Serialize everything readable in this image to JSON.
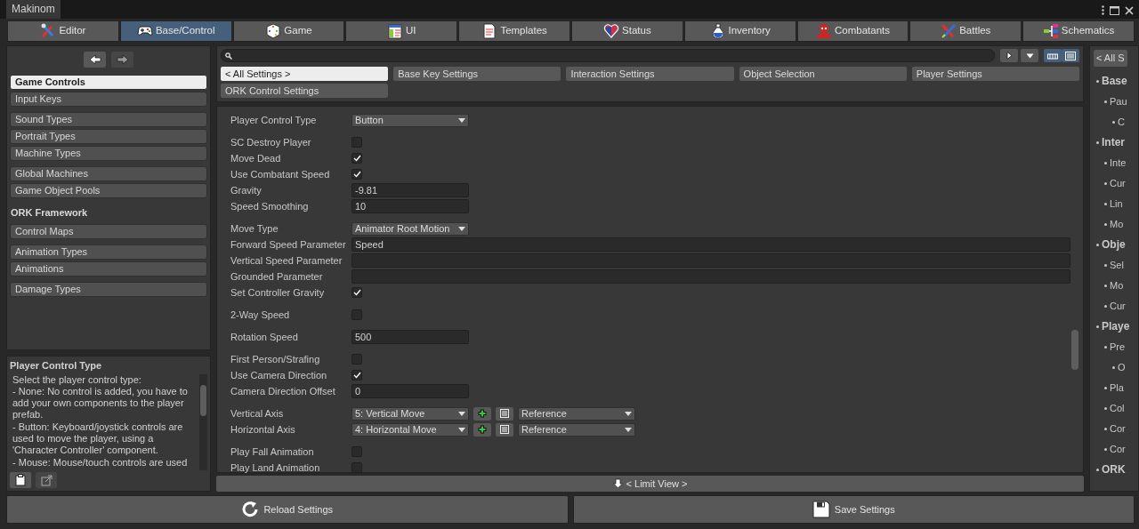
{
  "window": {
    "title": "Makinom"
  },
  "tabs": [
    {
      "label": "Editor",
      "selected": false
    },
    {
      "label": "Base/Control",
      "selected": true
    },
    {
      "label": "Game",
      "selected": false
    },
    {
      "label": "UI",
      "selected": false
    },
    {
      "label": "Templates",
      "selected": false
    },
    {
      "label": "Status",
      "selected": false
    },
    {
      "label": "Inventory",
      "selected": false
    },
    {
      "label": "Combatants",
      "selected": false
    },
    {
      "label": "Battles",
      "selected": false
    },
    {
      "label": "Schematics",
      "selected": false
    }
  ],
  "history": [
    {
      "disabled": false
    },
    {
      "disabled": true
    }
  ],
  "sidebar": {
    "sections": [
      {
        "items": [
          {
            "label": "Game Controls",
            "selected": true
          },
          {
            "label": "Input Keys",
            "selected": false
          }
        ]
      },
      {
        "items": [
          {
            "label": "Sound Types",
            "selected": false
          },
          {
            "label": "Portrait Types",
            "selected": false
          },
          {
            "label": "Machine Types",
            "selected": false
          }
        ]
      },
      {
        "items": [
          {
            "label": "Global Machines",
            "selected": false
          },
          {
            "label": "Game Object Pools",
            "selected": false
          }
        ]
      },
      {
        "header": "ORK Framework",
        "items": [
          {
            "label": "Control Maps",
            "selected": false
          }
        ]
      },
      {
        "items": [
          {
            "label": "Animation Types",
            "selected": false
          },
          {
            "label": "Animations",
            "selected": false
          }
        ]
      },
      {
        "items": [
          {
            "label": "Damage Types",
            "selected": false
          }
        ]
      }
    ]
  },
  "help": {
    "title": "Player Control Type",
    "text": "Select the player control type:\n- None: No control is added, you have to add your own components to the player prefab.\n- Button: Keyboard/joystick controls are used to move the player, using a 'Character Controller' component.\n- Mouse: Mouse/touch controls are used"
  },
  "view_toggles": [
    {
      "selected": true
    },
    {
      "selected": true
    }
  ],
  "sections": [
    {
      "label": "< All Settings >",
      "selected": true
    },
    {
      "label": "Base Key Settings",
      "selected": false
    },
    {
      "label": "Interaction Settings",
      "selected": false
    },
    {
      "label": "Object Selection",
      "selected": false
    },
    {
      "label": "Player Settings",
      "selected": false
    },
    {
      "label": "ORK Control Settings",
      "selected": false
    }
  ],
  "form": {
    "groups": [
      [
        {
          "kind": "dropdown",
          "label": "Player Control Type",
          "value": "Button"
        }
      ],
      [
        {
          "kind": "checkbox",
          "label": "SC Destroy Player",
          "checked": false
        },
        {
          "kind": "checkbox",
          "label": "Move Dead",
          "checked": true
        },
        {
          "kind": "checkbox",
          "label": "Use Combatant Speed",
          "checked": true
        },
        {
          "kind": "text",
          "label": "Gravity",
          "value": "-9.81"
        },
        {
          "kind": "text",
          "label": "Speed Smoothing",
          "value": "10"
        }
      ],
      [
        {
          "kind": "dropdown",
          "label": "Move Type",
          "value": "Animator Root Motion"
        },
        {
          "kind": "wide",
          "label": "Forward Speed Parameter",
          "value": "Speed"
        },
        {
          "kind": "wide",
          "label": "Vertical Speed Parameter"
        },
        {
          "kind": "wide",
          "label": "Grounded Parameter"
        },
        {
          "kind": "checkbox",
          "label": "Set Controller Gravity",
          "checked": true
        }
      ],
      [
        {
          "kind": "checkbox",
          "label": "2-Way Speed",
          "checked": false
        }
      ],
      [
        {
          "kind": "text",
          "label": "Rotation Speed",
          "value": "500"
        }
      ],
      [
        {
          "kind": "checkbox",
          "label": "First Person/Strafing",
          "checked": false
        },
        {
          "kind": "checkbox",
          "label": "Use Camera Direction",
          "checked": true
        },
        {
          "kind": "text",
          "label": "Camera Direction Offset",
          "value": "0"
        }
      ],
      [
        {
          "kind": "axis",
          "label": "Vertical Axis",
          "value": "5: Vertical Move",
          "source": "Reference"
        },
        {
          "kind": "axis",
          "label": "Horizontal Axis",
          "value": "4: Horizontal Move",
          "source": "Reference"
        }
      ],
      [
        {
          "kind": "checkbox",
          "label": "Play Fall Animation",
          "checked": false
        },
        {
          "kind": "checkbox",
          "label": "Play Land Animation",
          "checked": false
        }
      ]
    ]
  },
  "limit_view": {
    "label": "< Limit View >"
  },
  "outline": {
    "button": "< All S",
    "items": [
      {
        "label": "Base",
        "children": [
          {
            "label": "Pau",
            "children": [
              {
                "label": "C"
              }
            ]
          }
        ]
      },
      {
        "label": "Inter",
        "children": [
          {
            "label": "Inte"
          },
          {
            "label": "Cur"
          },
          {
            "label": "Lin"
          },
          {
            "label": "Mo"
          }
        ]
      },
      {
        "label": "Obje",
        "children": [
          {
            "label": "Sel"
          },
          {
            "label": "Mo"
          },
          {
            "label": "Cur"
          }
        ]
      },
      {
        "label": "Playe",
        "children": [
          {
            "label": "Pre",
            "children": [
              {
                "label": "O"
              }
            ]
          },
          {
            "label": "Pla"
          },
          {
            "label": "Col"
          },
          {
            "label": "Cor"
          },
          {
            "label": "Cor"
          }
        ]
      },
      {
        "label": "ORK"
      }
    ]
  },
  "footer": [
    {
      "kind": "reload",
      "label": "Reload Settings"
    },
    {
      "kind": "save",
      "label": "Save Settings"
    }
  ]
}
